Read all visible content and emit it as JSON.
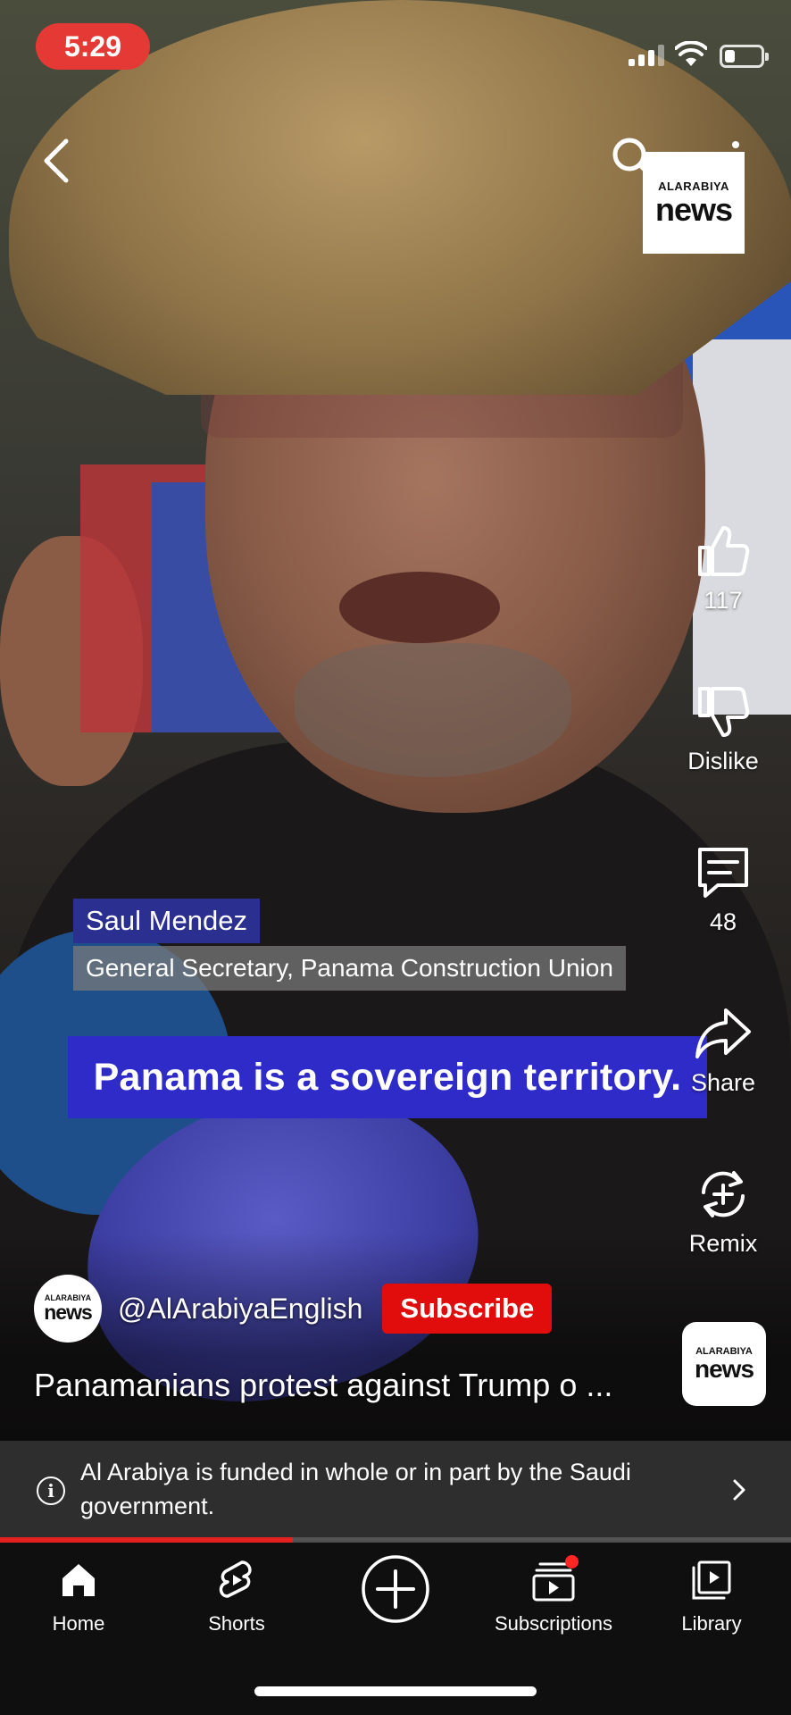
{
  "status_bar": {
    "time": "5:29",
    "battery_level": 0.3
  },
  "top_bar": {
    "back_icon": "chevron-left-icon",
    "search_icon": "search-icon",
    "more_icon": "more-vertical-icon"
  },
  "overlay_logo": {
    "line1": "ALARABIYA",
    "line2": "news"
  },
  "lower_third": {
    "name": "Saul Mendez",
    "title": "General Secretary, Panama Construction Union"
  },
  "caption": "Panama is a sovereign territory.",
  "actions": {
    "like": {
      "icon": "thumbs-up-icon",
      "label": "117"
    },
    "dislike": {
      "icon": "thumbs-down-icon",
      "label": "Dislike"
    },
    "comment": {
      "icon": "comment-icon",
      "label": "48"
    },
    "share": {
      "icon": "share-icon",
      "label": "Share"
    },
    "remix": {
      "icon": "remix-icon",
      "label": "Remix"
    }
  },
  "channel": {
    "avatar_line1": "ALARABIYA",
    "avatar_line2": "news",
    "handle": "@AlArabiyaEnglish",
    "subscribe_label": "Subscribe"
  },
  "video_title": "Panamanians protest against Trump o ...",
  "funding_notice": "Al Arabiya is funded in whole or in part by the Saudi government.",
  "progress": 0.37,
  "nav": {
    "items": [
      {
        "label": "Home",
        "icon": "home-icon"
      },
      {
        "label": "Shorts",
        "icon": "shorts-icon"
      },
      {
        "label": "",
        "icon": "create-plus-icon"
      },
      {
        "label": "Subscriptions",
        "icon": "subscriptions-icon"
      },
      {
        "label": "Library",
        "icon": "library-icon"
      }
    ]
  },
  "colors": {
    "accent_red": "#e10d0d",
    "caption_blue": "#2f2bc9",
    "name_tag_blue": "#2b2f8f"
  }
}
